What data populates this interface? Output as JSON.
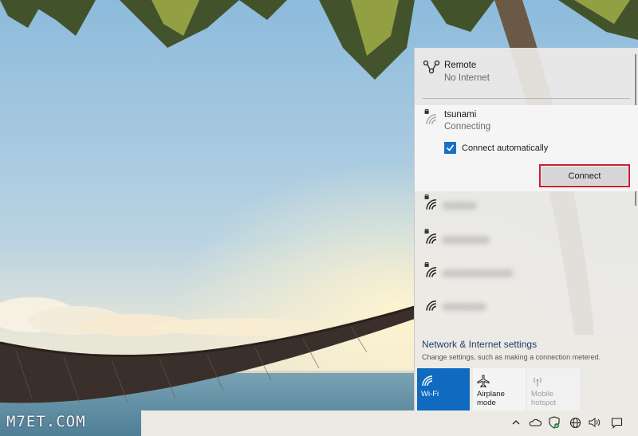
{
  "watermark": "M7ET.COM",
  "flyout": {
    "networks": [
      {
        "name": "Remote",
        "status": "No Internet",
        "icon": "remote-network-icon"
      },
      {
        "name": "tsunami",
        "status": "Connecting",
        "icon": "wifi-secured-icon",
        "auto_connect_label": "Connect automatically",
        "auto_connect_checked": true,
        "connect_label": "Connect"
      }
    ],
    "hidden_network_count": 4,
    "settings_link": "Network & Internet settings",
    "settings_desc": "Change settings, such as making a connection metered.",
    "tiles": [
      {
        "label": "Wi-Fi",
        "icon": "wifi-icon",
        "active": true
      },
      {
        "label": "Airplane mode",
        "icon": "airplane-icon",
        "active": false
      },
      {
        "label": "Mobile\nhotspot",
        "icon": "hotspot-icon",
        "active": false,
        "disabled": true
      }
    ]
  },
  "taskbar": {
    "tray_icons": [
      "chevron-up-icon",
      "onedrive-icon",
      "defender-icon",
      "network-globe-icon",
      "volume-icon",
      "notifications-icon"
    ]
  },
  "colors": {
    "accent": "#0f6ac0",
    "highlight_border": "#cc1f2b"
  }
}
